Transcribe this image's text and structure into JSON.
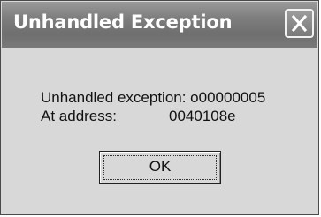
{
  "window": {
    "title": "Unhandled Exception"
  },
  "titlebar": {
    "close_icon": "close-icon"
  },
  "message": {
    "line1": "Unhandled exception: o00000005",
    "line2_label": "At address:",
    "line2_value": "0040108e"
  },
  "buttons": {
    "ok_label": "OK"
  }
}
